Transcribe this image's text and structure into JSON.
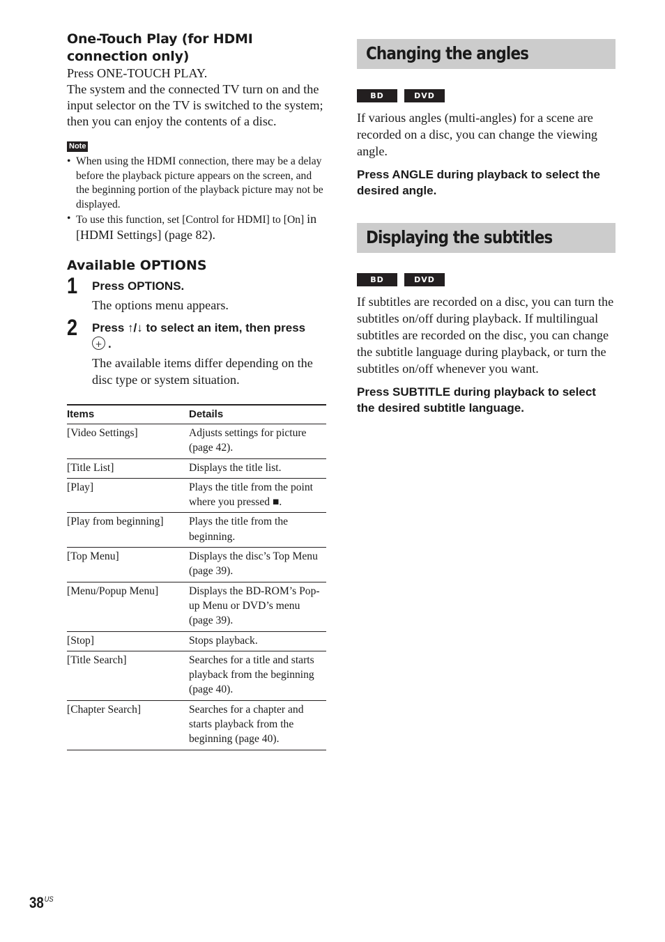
{
  "left": {
    "one_touch": {
      "heading": "One-Touch Play (for HDMI connection only)",
      "paragraphs": [
        "Press ONE-TOUCH PLAY.",
        "The system and the connected TV turn on and the input selector on the TV is switched to the system; then you can enjoy the contents of a disc."
      ]
    },
    "note": {
      "label": "Note",
      "bullet": "•",
      "items": [
        "When using the HDMI connection, there may be a delay before the playback picture appears on the screen, and the beginning portion of the playback picture may not be displayed.",
        "To use this function, set [Control for HDMI] to [On]"
      ],
      "item2_line2": "in [HDMI Settings] (page 82)."
    },
    "options": {
      "heading": "Available OPTIONS",
      "steps": [
        {
          "number": "1",
          "title": "Press OPTIONS.",
          "description": "The options menu appears."
        },
        {
          "number": "2",
          "title": "Press ↑/↓ to select an item, then press",
          "title_suffix": ".",
          "enter_icon": "enter-button-icon",
          "description": "The available items differ depending on the disc type or system situation."
        }
      ]
    },
    "table": {
      "headers": [
        "Items",
        "Details"
      ],
      "rows": [
        {
          "item": "[Video Settings]",
          "details": "Adjusts settings for picture (page 42)."
        },
        {
          "item": "[Title List]",
          "details": "Displays the title list."
        },
        {
          "item": "[Play]",
          "details": "Plays the title from the point where you pressed ■."
        },
        {
          "item": "[Play from beginning]",
          "details": "Plays the title from the beginning."
        },
        {
          "item": "[Top Menu]",
          "details": "Displays the disc’s Top Menu (page 39)."
        },
        {
          "item": "[Menu/Popup Menu]",
          "details": "Displays the BD-ROM’s Pop-up Menu or DVD’s menu (page 39)."
        },
        {
          "item": "[Stop]",
          "details": "Stops playback."
        },
        {
          "item": "[Title Search]",
          "details": "Searches for a title and starts playback from the beginning (page 40)."
        },
        {
          "item": "[Chapter Search]",
          "details": "Searches for a chapter and starts playback from the beginning (page 40)."
        }
      ]
    }
  },
  "right": {
    "angles": {
      "heading": "Changing the angles",
      "badges": [
        "BD",
        "DVD"
      ],
      "body": "If various angles (multi-angles) for a scene are recorded on a disc, you can change the viewing angle.",
      "instruction": "Press ANGLE during playback to select the desired angle."
    },
    "subtitles": {
      "heading": "Displaying the subtitles",
      "badges": [
        "BD",
        "DVD"
      ],
      "body": "If subtitles are recorded on a disc, you can turn the subtitles on/off during playback. If multilingual subtitles are recorded on the disc, you can change the subtitle language during playback, or turn the subtitles on/off whenever you want.",
      "instruction": "Press SUBTITLE during playback to select the desired subtitle language."
    }
  },
  "footer": {
    "page_number": "38",
    "region": "US"
  },
  "colors": {
    "section_bar": "#cccccc",
    "badge_bg": "#231f20",
    "text": "#1a1a1a"
  }
}
